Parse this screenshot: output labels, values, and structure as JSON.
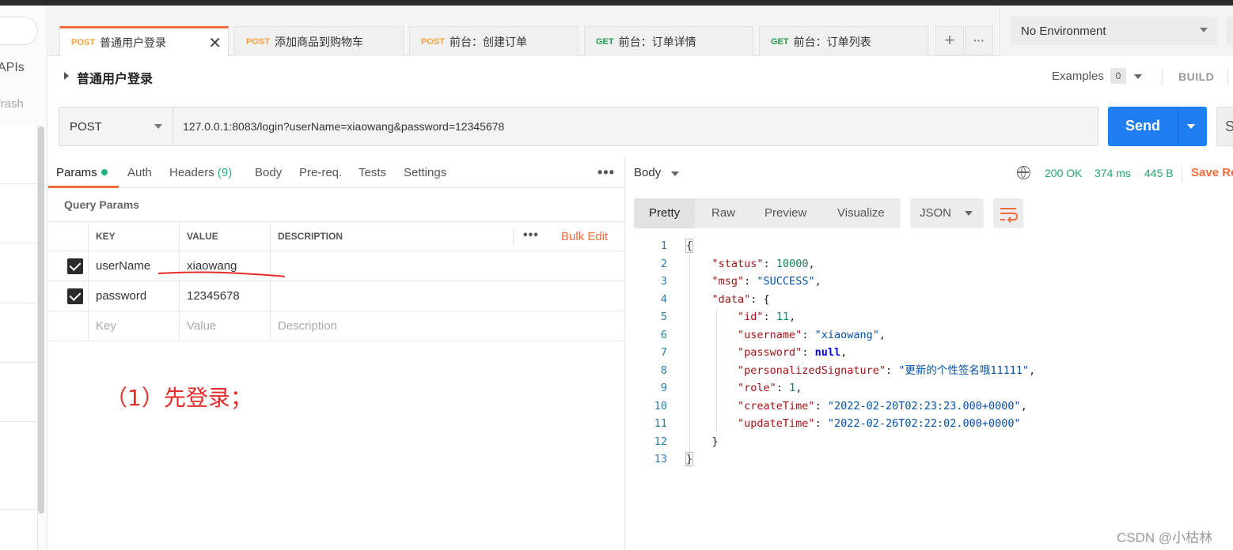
{
  "sidebar": {
    "apis_label": "APIs",
    "trash_label": "Trash"
  },
  "tabs": [
    {
      "method": "POST",
      "name": "普通用户登录",
      "active": true
    },
    {
      "method": "POST",
      "name": "添加商品到购物车"
    },
    {
      "method": "POST",
      "name": "前台：创建订单"
    },
    {
      "method": "GET",
      "name": "前台：订单详情"
    },
    {
      "method": "GET",
      "name": "前台：订单列表"
    }
  ],
  "tab_actions": {
    "add": "+",
    "more": "···"
  },
  "environment": {
    "selected": "No Environment"
  },
  "request": {
    "title": "普通用户登录",
    "examples_label": "Examples",
    "examples_count": "0",
    "build_label": "BUILD",
    "method": "POST",
    "url": "127.0.0.1:8083/login?userName=xiaowang&password=12345678",
    "send_label": "Send",
    "save_label": "S"
  },
  "request_tabs": {
    "params": "Params",
    "auth": "Auth",
    "headers": "Headers",
    "headers_count": "(9)",
    "body": "Body",
    "prereq": "Pre-req.",
    "tests": "Tests",
    "settings": "Settings"
  },
  "query_params": {
    "title": "Query Params",
    "headers": {
      "key": "KEY",
      "value": "VALUE",
      "description": "DESCRIPTION"
    },
    "bulk_edit": "Bulk Edit",
    "rows": [
      {
        "key": "userName",
        "value": "xiaowang",
        "checked": true
      },
      {
        "key": "password",
        "value": "12345678",
        "checked": true
      }
    ],
    "placeholders": {
      "key": "Key",
      "value": "Value",
      "description": "Description"
    }
  },
  "annotation": "（1）先登录；",
  "response": {
    "body_label": "Body",
    "status": "200 OK",
    "time": "374 ms",
    "size": "445 B",
    "save_label": "Save Re",
    "views": [
      "Pretty",
      "Raw",
      "Preview",
      "Visualize"
    ],
    "format": "JSON",
    "lines": [
      {
        "n": "1"
      },
      {
        "n": "2"
      },
      {
        "n": "3"
      },
      {
        "n": "4"
      },
      {
        "n": "5"
      },
      {
        "n": "6"
      },
      {
        "n": "7"
      },
      {
        "n": "8"
      },
      {
        "n": "9"
      },
      {
        "n": "10"
      },
      {
        "n": "11"
      },
      {
        "n": "12"
      },
      {
        "n": "13"
      }
    ],
    "json": {
      "status": "10000",
      "msg": "\"SUCCESS\"",
      "id": "11",
      "username": "\"xiaowang\"",
      "password": "null",
      "personalizedSignature": "\"更新的个性签名哦11111\"",
      "role": "1",
      "createTime": "\"2022-02-20T02:23:23.000+0000\"",
      "updateTime": "\"2022-02-26T02:22:02.000+0000\""
    }
  },
  "watermark": "CSDN @小枯林",
  "colors": {
    "accent": "#f26b3a",
    "send": "#1e7ef2",
    "status_ok": "#26a46b",
    "annotation": "#e52b2b"
  }
}
